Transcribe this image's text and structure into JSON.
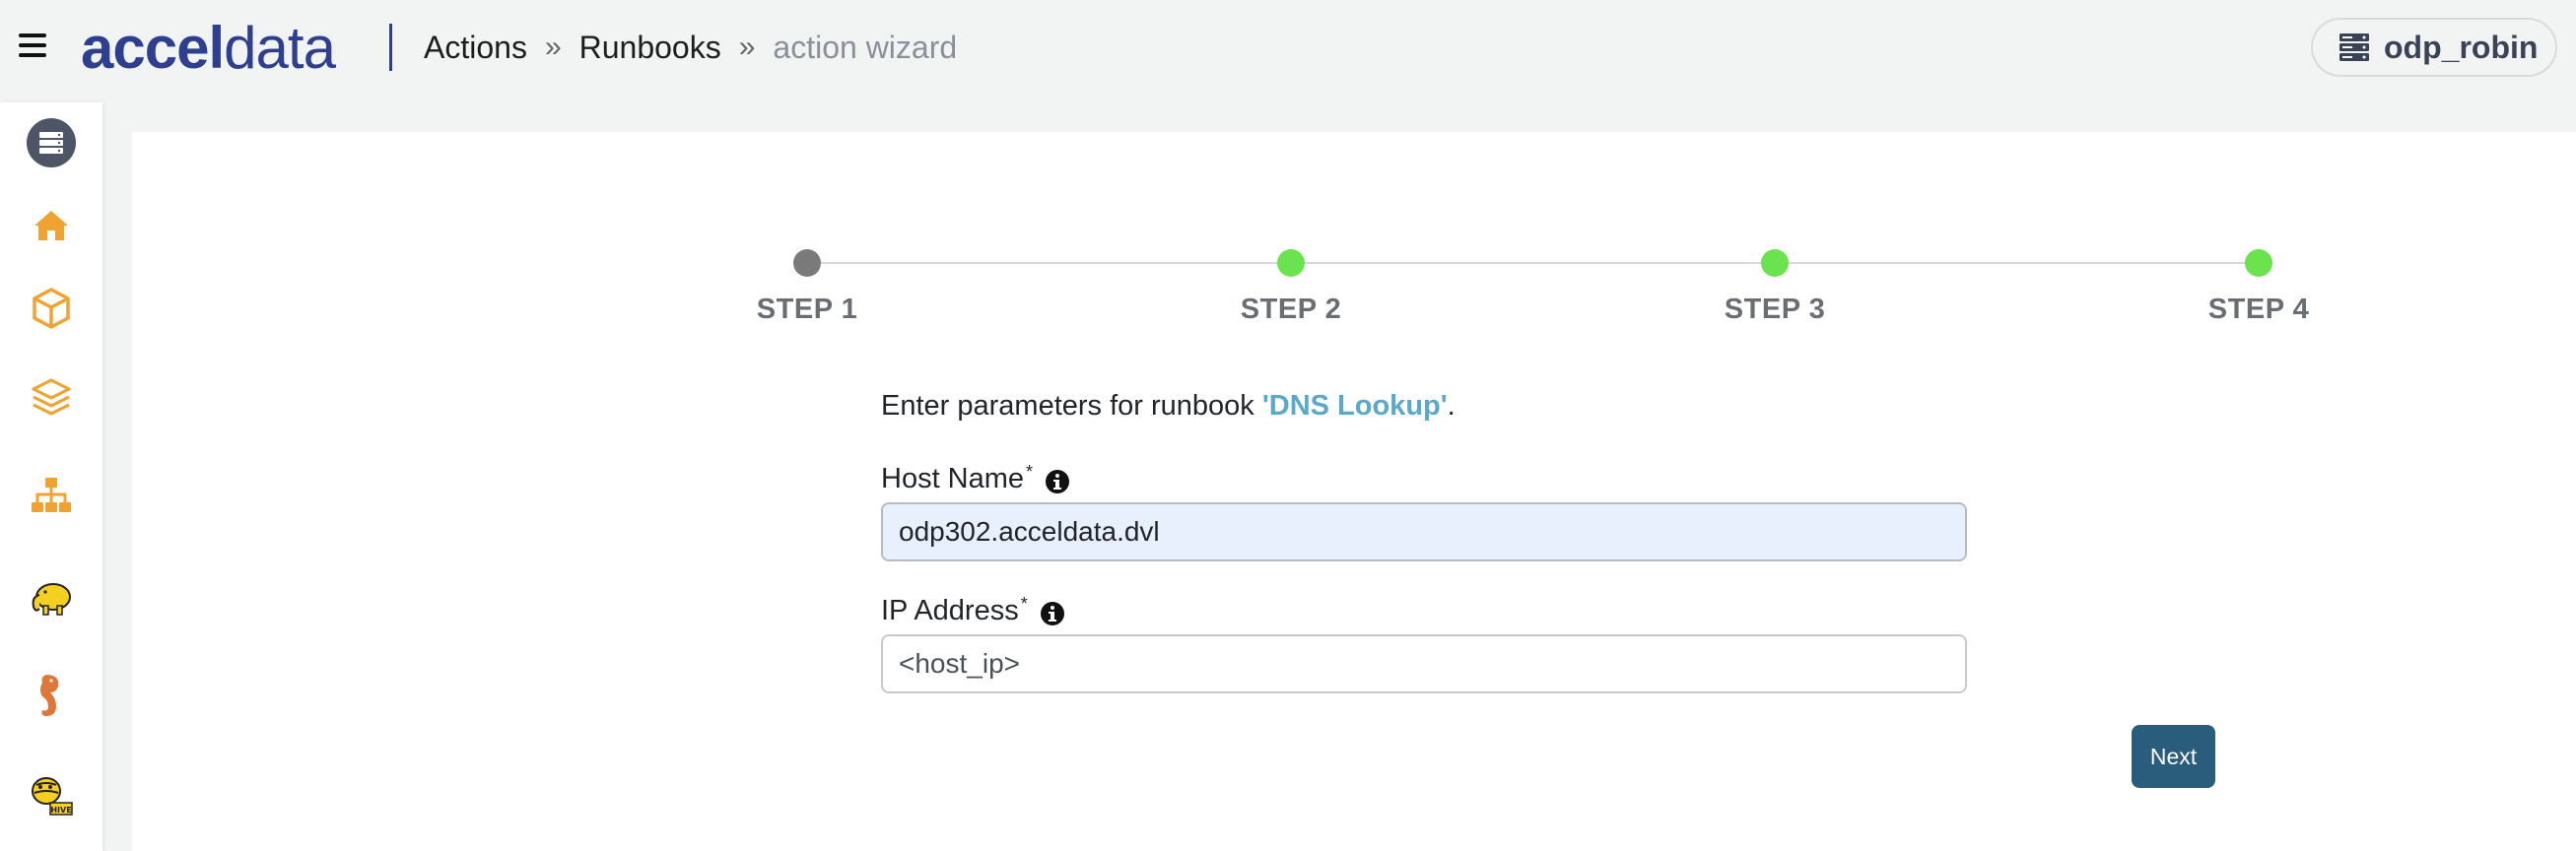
{
  "header": {
    "logo_text_bold": "accel",
    "logo_text_light": "data",
    "breadcrumb": [
      {
        "label": "Actions"
      },
      {
        "label": "Runbooks"
      },
      {
        "label": "action wizard"
      }
    ],
    "breadcrumb_separator": "»",
    "cluster_name": "odp_robin",
    "cluster_icon": "server-stack-icon"
  },
  "sidebar": {
    "items": [
      {
        "name": "server-stack-icon"
      },
      {
        "name": "home-icon"
      },
      {
        "name": "cube-icon"
      },
      {
        "name": "layers-icon"
      },
      {
        "name": "sitemap-icon"
      },
      {
        "name": "hadoop-elephant-icon"
      },
      {
        "name": "hbase-seahorse-icon"
      },
      {
        "name": "hive-bee-icon"
      }
    ]
  },
  "wizard": {
    "steps": [
      {
        "label": "STEP 1",
        "status": "current",
        "color": "#7a7a7a"
      },
      {
        "label": "STEP 2",
        "status": "pending",
        "color": "#6be34f"
      },
      {
        "label": "STEP 3",
        "status": "pending",
        "color": "#6be34f"
      },
      {
        "label": "STEP 4",
        "status": "pending",
        "color": "#6be34f"
      }
    ],
    "intro_prefix": "Enter parameters for runbook ",
    "runbook_name": "'DNS Lookup'",
    "intro_suffix": ".",
    "fields": {
      "host_name": {
        "label": "Host Name",
        "required_mark": "*",
        "value": "odp302.acceldata.dvl"
      },
      "ip_address": {
        "label": "IP Address",
        "required_mark": "*",
        "value": "",
        "placeholder": "<host_ip>"
      }
    },
    "next_label": "Next"
  },
  "colors": {
    "brand": "#2e3f8f",
    "accent_orange": "#f0a330",
    "link_teal": "#5aa9c9",
    "button": "#2a5c7c"
  }
}
